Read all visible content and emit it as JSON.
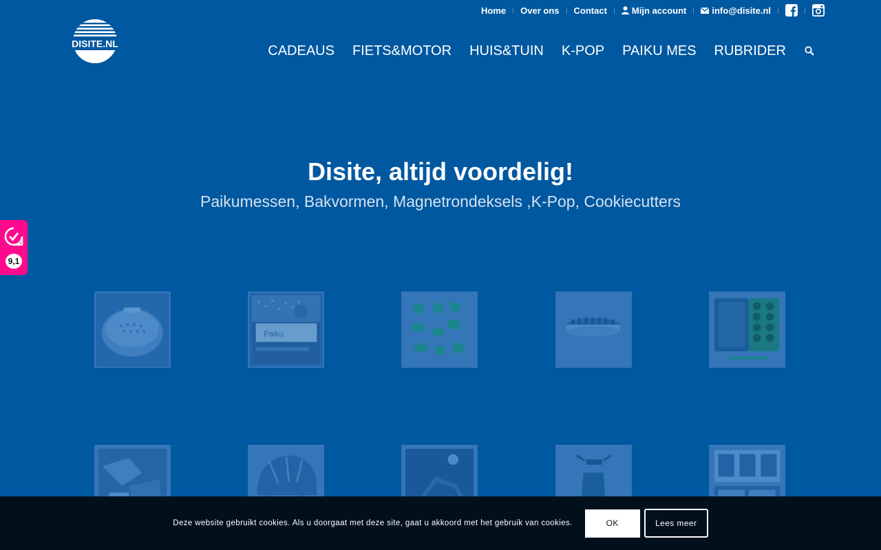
{
  "topbar": {
    "links": [
      {
        "label": "Home"
      },
      {
        "label": "Over ons"
      },
      {
        "label": "Contact"
      },
      {
        "label": "Mijn account",
        "icon": "user-icon"
      },
      {
        "label": "info@disite.nl",
        "icon": "mail-icon"
      }
    ],
    "social": [
      {
        "icon": "facebook-icon"
      },
      {
        "icon": "instagram-icon"
      }
    ]
  },
  "logo": {
    "text": "DISITE.NL"
  },
  "nav": {
    "items": [
      "CADEAUS",
      "FIETS&MOTOR",
      "HUIS&TUIN",
      "K-POP",
      "PAIKU MES",
      "RUBRIDER"
    ],
    "search_icon": "search-icon"
  },
  "hero": {
    "title": "Disite, altijd voordelig!",
    "subtitle": "Paikumessen, Bakvormen, Magnetrondeksels ,K-Pop, Cookiecutters"
  },
  "review_badge": {
    "score": "9,1",
    "icon": "review-check-icon"
  },
  "products": [
    {
      "icon": "microwave-cover-icon"
    },
    {
      "icon": "paiku-knife-icon"
    },
    {
      "icon": "dinosaur-cookiecutters-icon"
    },
    {
      "icon": "cake-tin-icon"
    },
    {
      "icon": "baking-mold-icon"
    },
    {
      "icon": "tools-icon"
    },
    {
      "icon": "helmet-icon"
    },
    {
      "icon": "motorcycle-icon"
    },
    {
      "icon": "scooter-icon"
    },
    {
      "icon": "kpop-poster-icon"
    }
  ],
  "cookie": {
    "text": "Deze website gebruikt cookies. Als u doorgaat met deze site, gaat u akkoord met het gebruik van cookies.",
    "ok_label": "OK",
    "more_label": "Lees meer"
  },
  "colors": {
    "background": "#0058a0",
    "review_pink": "#ff0a8c",
    "cookie_bar": "#02101c"
  }
}
